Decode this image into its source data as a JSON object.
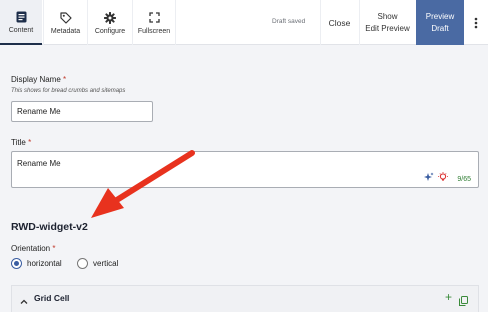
{
  "toolbar": {
    "tabs": [
      {
        "label": "Content",
        "icon": "document-icon"
      },
      {
        "label": "Metadata",
        "icon": "tag-icon"
      },
      {
        "label": "Configure",
        "icon": "gear-icon"
      },
      {
        "label": "Fullscreen",
        "icon": "fullscreen-icon"
      }
    ],
    "status": "Draft saved",
    "close_label": "Close",
    "show_line1": "Show",
    "show_line2": "Edit Preview",
    "preview_line1": "Preview",
    "preview_line2": "Draft"
  },
  "form": {
    "display_name": {
      "label": "Display Name",
      "required_mark": "*",
      "help": "This shows for bread crumbs and sitemaps",
      "value": "Rename Me"
    },
    "title": {
      "label": "Title",
      "required_mark": "*",
      "value": "Rename Me",
      "counter": "9/65"
    },
    "widget_heading": "RWD-widget-v2",
    "orientation": {
      "label": "Orientation",
      "required_mark": "*",
      "options": [
        "horizontal",
        "vertical"
      ],
      "selected": "horizontal"
    },
    "grid_panel": {
      "title": "Grid Cell",
      "add_symbol": "+"
    }
  },
  "colors": {
    "accent": "#4a6aa3",
    "annotation_arrow": "#e8321e",
    "required": "#c0392b",
    "counter_ok": "#2e7d32"
  }
}
